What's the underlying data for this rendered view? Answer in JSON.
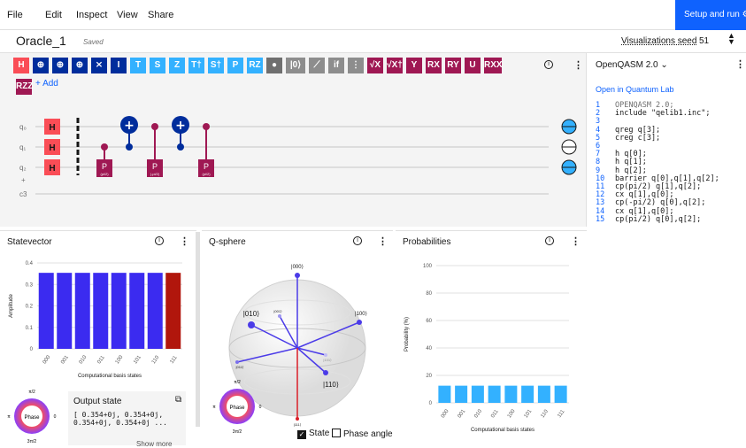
{
  "menu": [
    "File",
    "Edit",
    "Inspect",
    "View",
    "Share"
  ],
  "setup_button": "Setup and run",
  "file": {
    "name": "Oracle_1",
    "status": "Saved"
  },
  "seed": {
    "label": "Visualizations seed",
    "value": "51"
  },
  "gates_row1": [
    "H",
    "⊕",
    "⊕",
    "⊕",
    "⨯",
    "I",
    "T",
    "S",
    "Z",
    "T†",
    "S†",
    "P",
    "RZ",
    "●",
    "|0⟩",
    "⟋",
    "if",
    "⋮",
    "√X",
    "√X†",
    "Y",
    "RX",
    "RY",
    "U",
    "RXX"
  ],
  "gates_row2": [
    "RZZ"
  ],
  "add_label": "+ Add",
  "circuit": {
    "qubits": [
      "q₀",
      "q₁",
      "q₂"
    ],
    "classical": "c3",
    "phase_labels": [
      "P",
      "P",
      "P"
    ],
    "phase_params": [
      "(pi/2)",
      "(-pi/2)",
      "(pi/2)"
    ]
  },
  "qasm": {
    "title": "OpenQASM 2.0",
    "link": "Open in Quantum Lab",
    "lines": [
      "OPENQASM 2.0;",
      "include \"qelib1.inc\";",
      "",
      "qreg q[3];",
      "creg c[3];",
      "",
      "h q[0];",
      "h q[1];",
      "h q[2];",
      "barrier q[0],q[1],q[2];",
      "cp(pi/2) q[1],q[2];",
      "cx q[1],q[0];",
      "cp(-pi/2) q[0],q[2];",
      "cx q[1],q[0];",
      "cp(pi/2) q[0],q[2];"
    ]
  },
  "statevector": {
    "title": "Statevector",
    "ylabel": "Amplitude",
    "xlabel": "Computational basis states",
    "ticks": [
      "0",
      "0.1",
      "0.2",
      "0.3",
      "0.4"
    ],
    "output_title": "Output state",
    "output_text": "[ 0.354+0j, 0.354+0j,\n0.354+0j, 0.354+0j ...",
    "show_more": "Show more",
    "phase_label": "Phase",
    "phase_marks": [
      "π/2",
      "π",
      "0",
      "3π/2"
    ]
  },
  "qsphere": {
    "title": "Q-sphere",
    "state_labels": [
      "|000⟩",
      "|010⟩",
      "|001⟩",
      "|100⟩",
      "|011⟩",
      "|110⟩",
      "|111⟩",
      "|101⟩"
    ],
    "phase_label": "Phase",
    "phase_marks": [
      "π/2",
      "π",
      "0",
      "3π/2"
    ],
    "state_checkbox": "State",
    "phase_checkbox": "Phase angle"
  },
  "probabilities": {
    "title": "Probabilities",
    "ylabel": "Probability (%)",
    "xlabel": "Computational basis states",
    "ticks": [
      "0",
      "20",
      "40",
      "60",
      "80",
      "100"
    ]
  },
  "chart_data": [
    {
      "type": "bar",
      "xlabel": "Computational basis states",
      "ylabel": "Amplitude",
      "categories": [
        "000",
        "001",
        "010",
        "011",
        "100",
        "101",
        "110",
        "111"
      ],
      "values": [
        0.354,
        0.354,
        0.354,
        0.354,
        0.354,
        0.354,
        0.354,
        0.354
      ],
      "ylim": [
        0,
        0.4
      ],
      "colors": [
        "#3b2bf0",
        "#3b2bf0",
        "#3b2bf0",
        "#3b2bf0",
        "#3b2bf0",
        "#3b2bf0",
        "#3b2bf0",
        "#b1160c"
      ]
    },
    {
      "type": "bar",
      "xlabel": "Computational basis states",
      "ylabel": "Probability (%)",
      "categories": [
        "000",
        "001",
        "010",
        "011",
        "100",
        "101",
        "110",
        "111"
      ],
      "values": [
        12.5,
        12.5,
        12.5,
        12.5,
        12.5,
        12.5,
        12.5,
        12.5
      ],
      "ylim": [
        0,
        100
      ],
      "color": "#33b1ff"
    }
  ]
}
